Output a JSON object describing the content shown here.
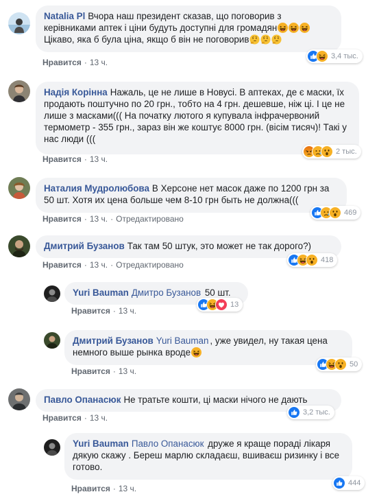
{
  "comments": [
    {
      "author": "Natalia Pl",
      "text": "Вчора наш президент сказав, що поговорив з керівниками аптек і ціни будуть доступні для громадян",
      "text2": "Цікаво, яка б була ціна, якщо б він не поговорив",
      "like_label": "Нравится",
      "time": "13 ч.",
      "reaction_count": "3,4 тыс."
    },
    {
      "author": "Надія Корінна",
      "text": "Нажаль, це не лише в Новусі. В аптеках, де є маски, їх продають поштучно по 20 грн., тобто на 4 грн. дешевше, ніж ці. І це не лише з масками((( На початку лютого я купувала інфрачервоний термометр - 355 грн., зараз він же коштує 8000 грн. (вісім тисяч)! Такі у нас люди (((",
      "like_label": "Нравится",
      "time": "13 ч.",
      "reaction_count": "2 тыс."
    },
    {
      "author": "Наталия Мудролюбова",
      "text": "В Херсоне нет масок даже по 1200 грн за 50 шт. Хотя их цена больше чем 8-10 грн быть не должна(((",
      "like_label": "Нравится",
      "time": "13 ч.",
      "edited": "Отредактировано",
      "reaction_count": "469"
    },
    {
      "author": "Дмитрий Бузанов",
      "text": "Так там 50 штук, это может не так дорого?)",
      "like_label": "Нравится",
      "time": "13 ч.",
      "edited": "Отредактировано",
      "reaction_count": "418"
    },
    {
      "author": "Yuri Bauman",
      "mention": "Дмитро Бузанов",
      "text": "50 шт.",
      "like_label": "Нравится",
      "time": "13 ч.",
      "reaction_count": "13"
    },
    {
      "author": "Дмитрий Бузанов",
      "mention": "Yuri Bauman",
      "text": ", уже увидел, ну такая цена немного выше рынка вроде",
      "like_label": "Нравится",
      "time": "13 ч.",
      "reaction_count": "50"
    },
    {
      "author": "Павло Опанасюк",
      "text": "Не тратьте кошти, ці маски нічого не дають",
      "like_label": "Нравится",
      "time": "13 ч.",
      "reaction_count": "3,2 тыс."
    },
    {
      "author": "Yuri Bauman",
      "mention": "Павло Опанасюк",
      "text": "друже я краще пораді лікаря дякую скажу . Береш марлю складаєш, вшиваєш ризинку і все готово.",
      "like_label": "Нравится",
      "time": "13 ч.",
      "reaction_count": "444"
    }
  ],
  "colors": {
    "link": "#385898",
    "bubble": "#f2f3f5",
    "meta": "#606770",
    "like_blue": "#1877f2",
    "haha_yellow": "#f7b125",
    "angry_orange": "#e9710f",
    "love_red": "#f33e58"
  }
}
